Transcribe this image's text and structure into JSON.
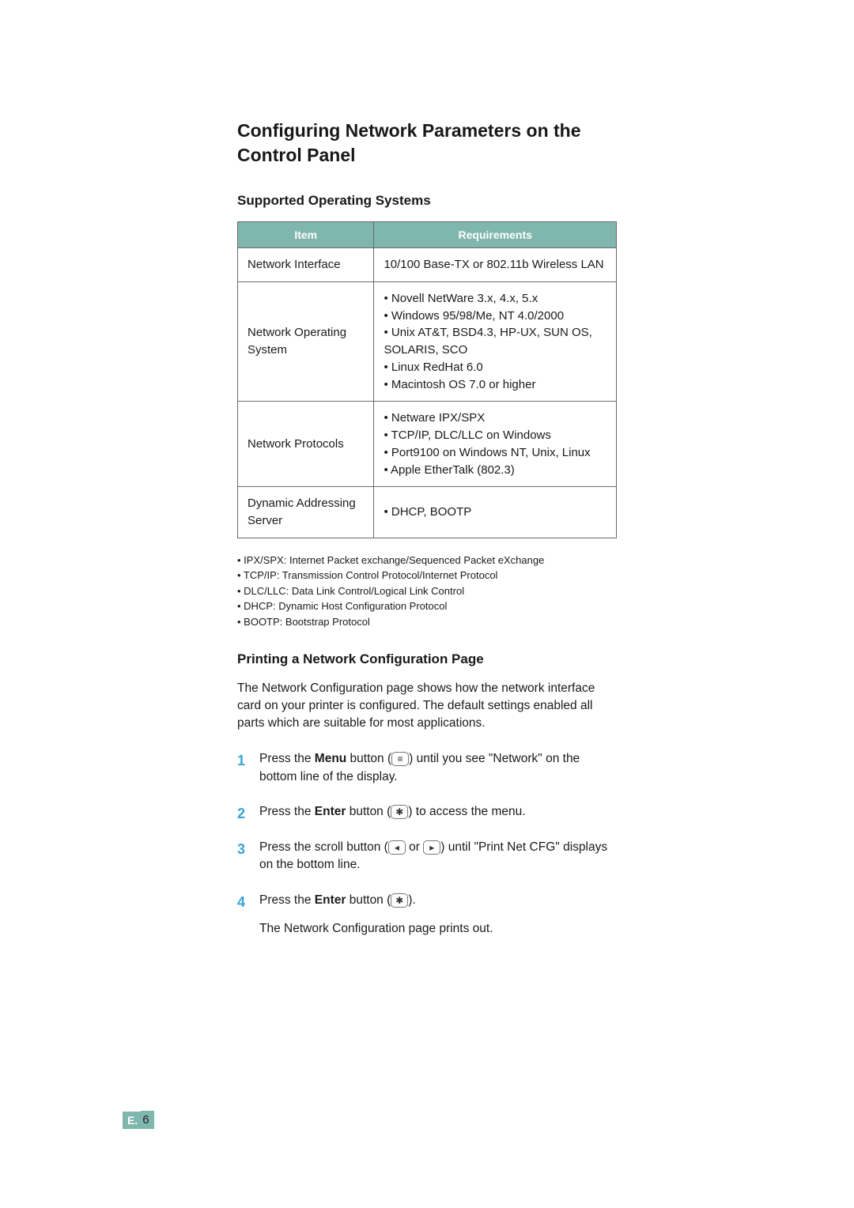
{
  "headings": {
    "h1": "Configuring Network Parameters on the Control Panel",
    "h2a": "Supported Operating Systems",
    "h2b": "Printing a Network Configuration Page"
  },
  "table": {
    "headers": {
      "item": "Item",
      "req": "Requirements"
    },
    "rows": [
      {
        "item": "Network Interface",
        "req": "10/100 Base-TX or 802.11b Wireless LAN"
      },
      {
        "item": "Network Operating System",
        "req": "• Novell NetWare 3.x, 4.x, 5.x\n• Windows 95/98/Me, NT 4.0/2000\n• Unix AT&T, BSD4.3, HP-UX, SUN OS,\n   SOLARIS, SCO\n• Linux RedHat 6.0\n• Macintosh OS 7.0 or higher"
      },
      {
        "item": "Network Protocols",
        "req": "• Netware IPX/SPX\n• TCP/IP, DLC/LLC on Windows\n• Port9100 on Windows NT, Unix, Linux\n• Apple EtherTalk (802.3)"
      },
      {
        "item": "Dynamic Addressing Server",
        "req": "• DHCP, BOOTP"
      }
    ]
  },
  "glossary": [
    "• IPX/SPX: Internet Packet exchange/Sequenced Packet eXchange",
    "• TCP/IP: Transmission Control Protocol/Internet Protocol",
    "• DLC/LLC: Data Link Control/Logical Link Control",
    "• DHCP: Dynamic Host Configuration Protocol",
    "• BOOTP: Bootstrap Protocol"
  ],
  "intro": "The Network Configuration page shows how the network interface card on your printer is configured. The default settings enabled all parts which are suitable for most applications.",
  "steps": {
    "s1a": "Press the ",
    "s1b": "Menu",
    "s1c": " button (",
    "s1d": ") until you see \"Network\" on the bottom line of the display.",
    "s2a": "Press the ",
    "s2b": "Enter",
    "s2c": " button (",
    "s2d": ") to access the menu.",
    "s3a": "Press the scroll button (",
    "s3b": " or ",
    "s3c": ") until \"Print Net CFG\" displays on the bottom line.",
    "s4a": "Press the ",
    "s4b": "Enter",
    "s4c": " button (",
    "s4d": ").",
    "s4sub": "The Network Configuration page prints out."
  },
  "icons": {
    "menu": "≡",
    "enter": "✱",
    "left": "◂",
    "right": "▸"
  },
  "pager": {
    "section": "E.",
    "num": "6"
  }
}
